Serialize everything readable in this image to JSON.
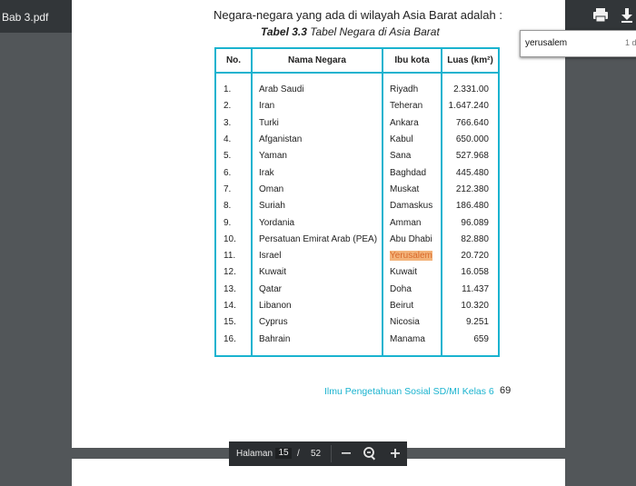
{
  "toolbar": {
    "file_title": "Bab 3.pdf",
    "print_icon": "print-icon",
    "download_icon": "download-icon"
  },
  "document": {
    "cut_text": "· · · ·",
    "intro": "Negara-negara yang ada di wilayah Asia Barat adalah :",
    "caption_bold": "Tabel 3.3",
    "caption_rest": " Tabel Negara di Asia Barat",
    "table": {
      "headers": [
        "No.",
        "Nama Negara",
        "Ibu kota",
        "Luas (km²)"
      ],
      "rows": [
        {
          "no": "1.",
          "name": "Arab Saudi",
          "capital": "Riyadh",
          "area": "2.331.00"
        },
        {
          "no": "2.",
          "name": "Iran",
          "capital": "Teheran",
          "area": "1.647.240"
        },
        {
          "no": "3.",
          "name": "Turki",
          "capital": "Ankara",
          "area": "766.640"
        },
        {
          "no": "4.",
          "name": "Afganistan",
          "capital": "Kabul",
          "area": "650.000"
        },
        {
          "no": "5.",
          "name": "Yaman",
          "capital": "Sana",
          "area": "527.968"
        },
        {
          "no": "6.",
          "name": "Irak",
          "capital": "Baghdad",
          "area": "445.480"
        },
        {
          "no": "7.",
          "name": "Oman",
          "capital": "Muskat",
          "area": "212.380"
        },
        {
          "no": "8.",
          "name": "Suriah",
          "capital": "Damaskus",
          "area": "186.480"
        },
        {
          "no": "9.",
          "name": "Yordania",
          "capital": "Amman",
          "area": "96.089"
        },
        {
          "no": "10.",
          "name": "Persatuan Emirat Arab (PEA)",
          "capital": "Abu Dhabi",
          "area": "82.880"
        },
        {
          "no": "11.",
          "name": "Israel",
          "capital": "Yerusalem",
          "area": "20.720"
        },
        {
          "no": "12.",
          "name": "Kuwait",
          "capital": "Kuwait",
          "area": "16.058"
        },
        {
          "no": "13.",
          "name": "Qatar",
          "capital": "Doha",
          "area": "11.437"
        },
        {
          "no": "14.",
          "name": "Libanon",
          "capital": "Beirut",
          "area": "10.320"
        },
        {
          "no": "15.",
          "name": "Cyprus",
          "capital": "Nicosia",
          "area": "9.251"
        },
        {
          "no": "16.",
          "name": "Bahrain",
          "capital": "Manama",
          "area": "659"
        }
      ],
      "highlighted_capital": "Yerusalem"
    },
    "footer": "Ilmu Pengetahuan Sosial SD/MI Kelas 6",
    "page_number": "69"
  },
  "find": {
    "query": "yerusalem",
    "count": "1 d"
  },
  "pagebar": {
    "label": "Halaman",
    "current": "15",
    "separator": "/",
    "total": "52",
    "zoom_out_icon": "zoom-out-icon",
    "zoom_fit_icon": "zoom-fit-icon",
    "zoom_in_icon": "zoom-in-icon"
  },
  "colors": {
    "table_border": "#1ab3cf",
    "highlight": "#f3b37a",
    "viewer_bg": "#525659"
  }
}
